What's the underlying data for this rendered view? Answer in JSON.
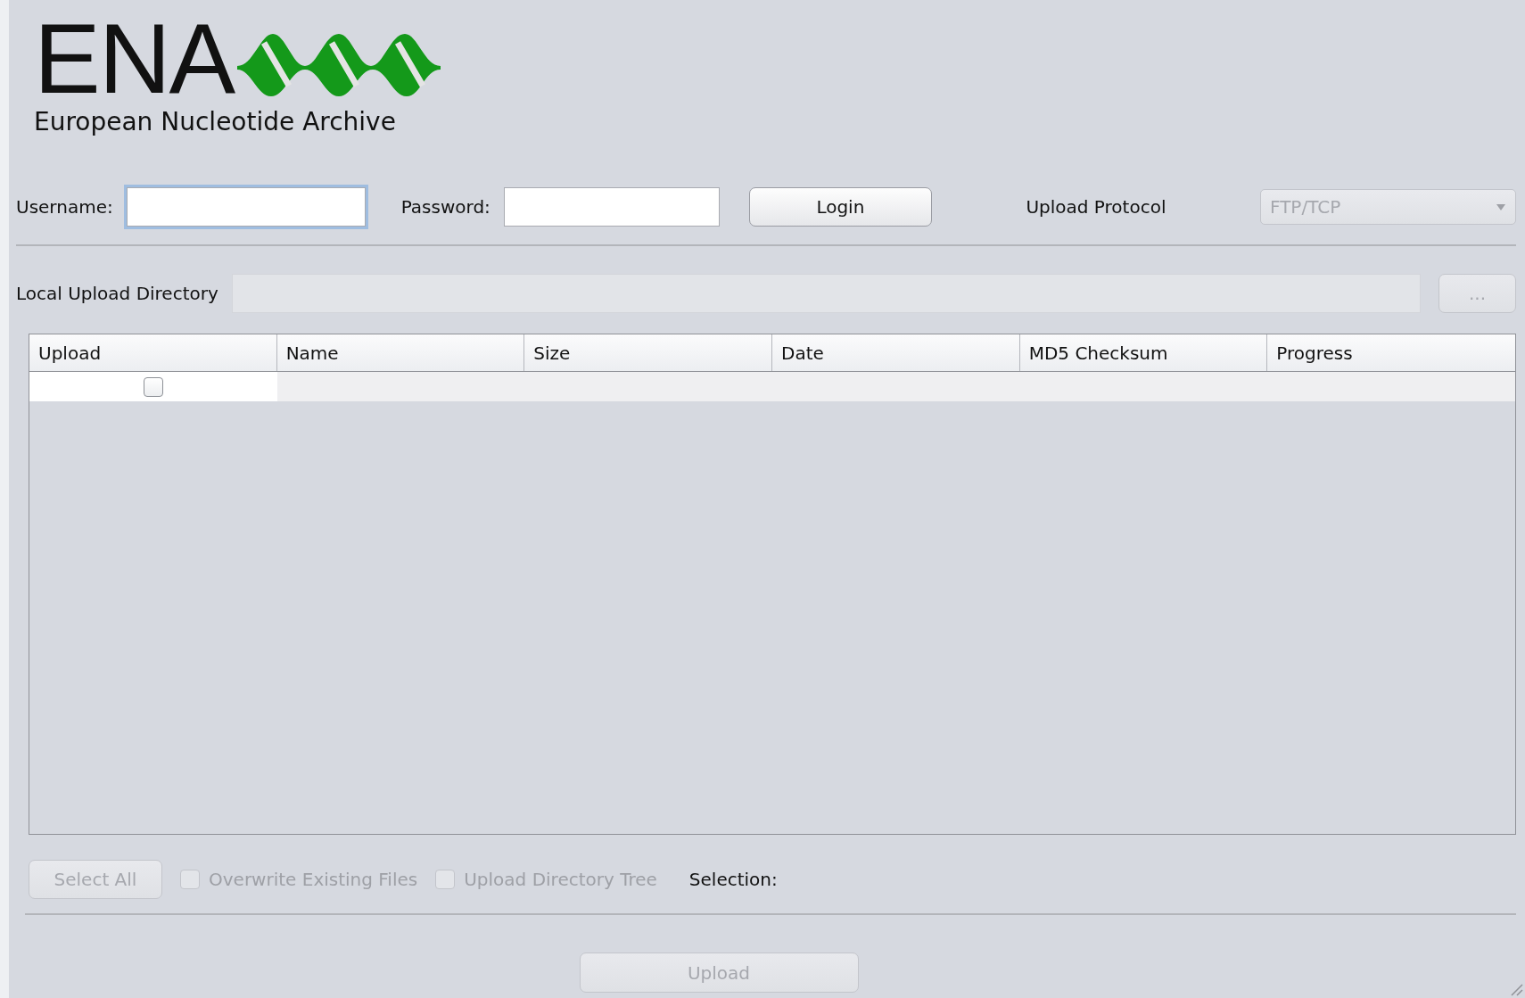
{
  "logo": {
    "title": "ENA",
    "subtitle": "European Nucleotide Archive"
  },
  "login": {
    "username_label": "Username:",
    "username_focused": true,
    "password_label": "Password:",
    "login_button": "Login",
    "protocol_label": "Upload Protocol",
    "protocol": {
      "value": "FTP/TCP",
      "disabled": true
    }
  },
  "directory": {
    "label": "Local Upload Directory",
    "disabled": true,
    "browse_button": {
      "label": "...",
      "disabled": true
    }
  },
  "table": {
    "columns": [
      "Upload",
      "Name",
      "Size",
      "Date",
      "MD5 Checksum",
      "Progress"
    ],
    "rows": [
      {
        "checked": false
      }
    ]
  },
  "options": {
    "select_all": {
      "label": "Select All",
      "disabled": true
    },
    "checkboxes": [
      {
        "label": "Overwrite Existing Files",
        "checked": false,
        "disabled": true
      },
      {
        "label": "Upload Directory Tree",
        "checked": false,
        "disabled": true
      }
    ],
    "selection_label": "Selection:"
  },
  "upload_button": {
    "label": "Upload",
    "disabled": true
  }
}
